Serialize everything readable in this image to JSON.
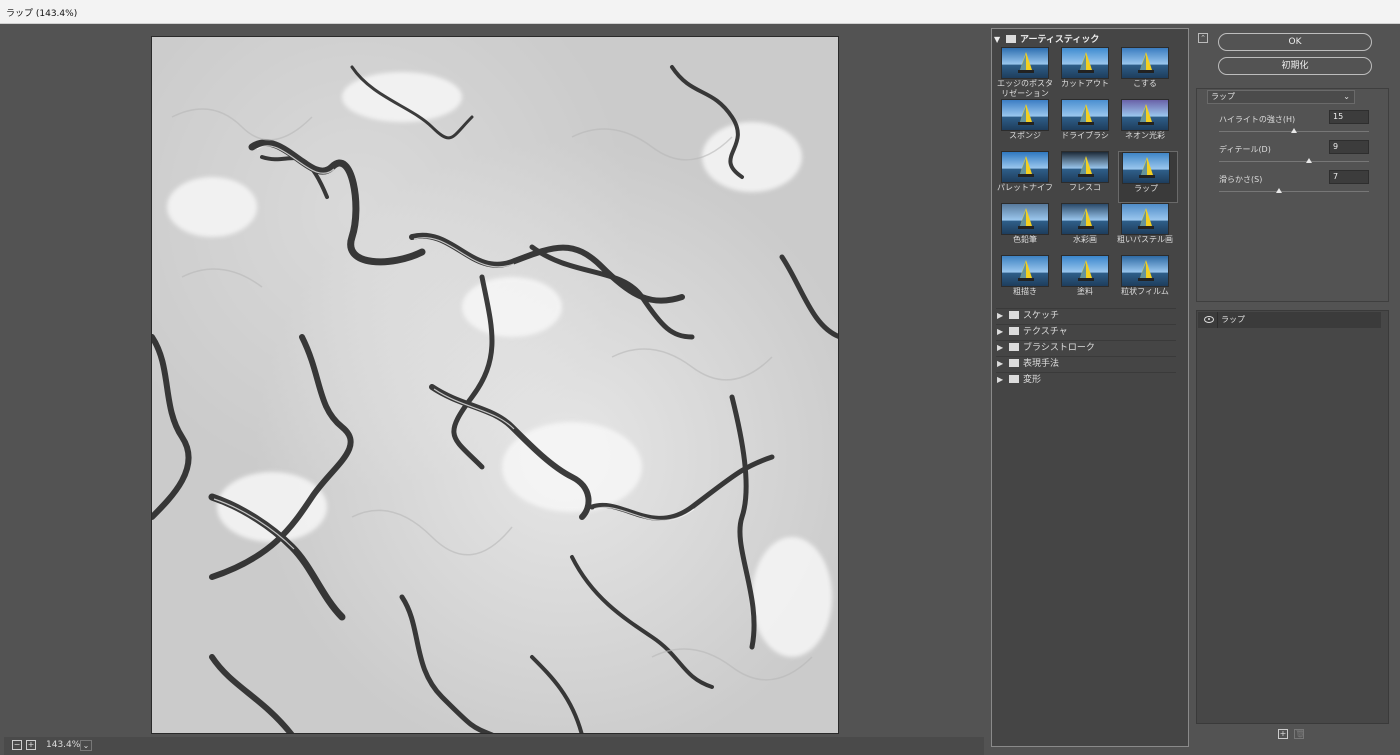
{
  "window": {
    "title": "ラップ (143.4%)"
  },
  "preview": {
    "zoom": "143.4%",
    "zoom_out_symbol": "−",
    "zoom_in_symbol": "+"
  },
  "gallery": {
    "open_category": "アーティスティック",
    "thumbnails": [
      {
        "label": "エッジのポスタリゼーション",
        "selected": false,
        "tint": "#2e6fb0"
      },
      {
        "label": "カットアウト",
        "selected": false,
        "tint": "#3f8cd0"
      },
      {
        "label": "こする",
        "selected": false,
        "tint": "#3a7cc0"
      },
      {
        "label": "スポンジ",
        "selected": false,
        "tint": "#3b7dc4"
      },
      {
        "label": "ドライブラシ",
        "selected": false,
        "tint": "#4a8fd0"
      },
      {
        "label": "ネオン光彩",
        "selected": false,
        "tint": "#6a62a8"
      },
      {
        "label": "パレットナイフ",
        "selected": false,
        "tint": "#2f78c0"
      },
      {
        "label": "フレスコ",
        "selected": false,
        "tint": "#1d2a38"
      },
      {
        "label": "ラップ",
        "selected": true,
        "tint": "#3f85c6"
      },
      {
        "label": "色鉛筆",
        "selected": false,
        "tint": "#587a9c"
      },
      {
        "label": "水彩画",
        "selected": false,
        "tint": "#2b4a6a"
      },
      {
        "label": "粗いパステル画",
        "selected": false,
        "tint": "#4f8cc8"
      },
      {
        "label": "粗描き",
        "selected": false,
        "tint": "#3d82c2"
      },
      {
        "label": "塗料",
        "selected": false,
        "tint": "#3a86cc"
      },
      {
        "label": "粒状フィルム",
        "selected": false,
        "tint": "#2e6aa4"
      }
    ],
    "categories": [
      "スケッチ",
      "テクスチャ",
      "ブラシストローク",
      "表現手法",
      "変形"
    ]
  },
  "buttons": {
    "ok": "OK",
    "reset": "初期化",
    "collapse_symbol": "⌃"
  },
  "filter_select": {
    "value": "ラップ"
  },
  "params": [
    {
      "label": "ハイライトの強さ(H)",
      "value": "15",
      "level": 0.5
    },
    {
      "label": "ディテール(D)",
      "value": "9",
      "level": 0.6
    },
    {
      "label": "滑らかさ(S)",
      "value": "7",
      "level": 0.4
    }
  ],
  "layers": [
    {
      "name": "ラップ"
    }
  ],
  "layer_buttons": {
    "new_symbol": "+",
    "delete_symbol": "🗑"
  }
}
